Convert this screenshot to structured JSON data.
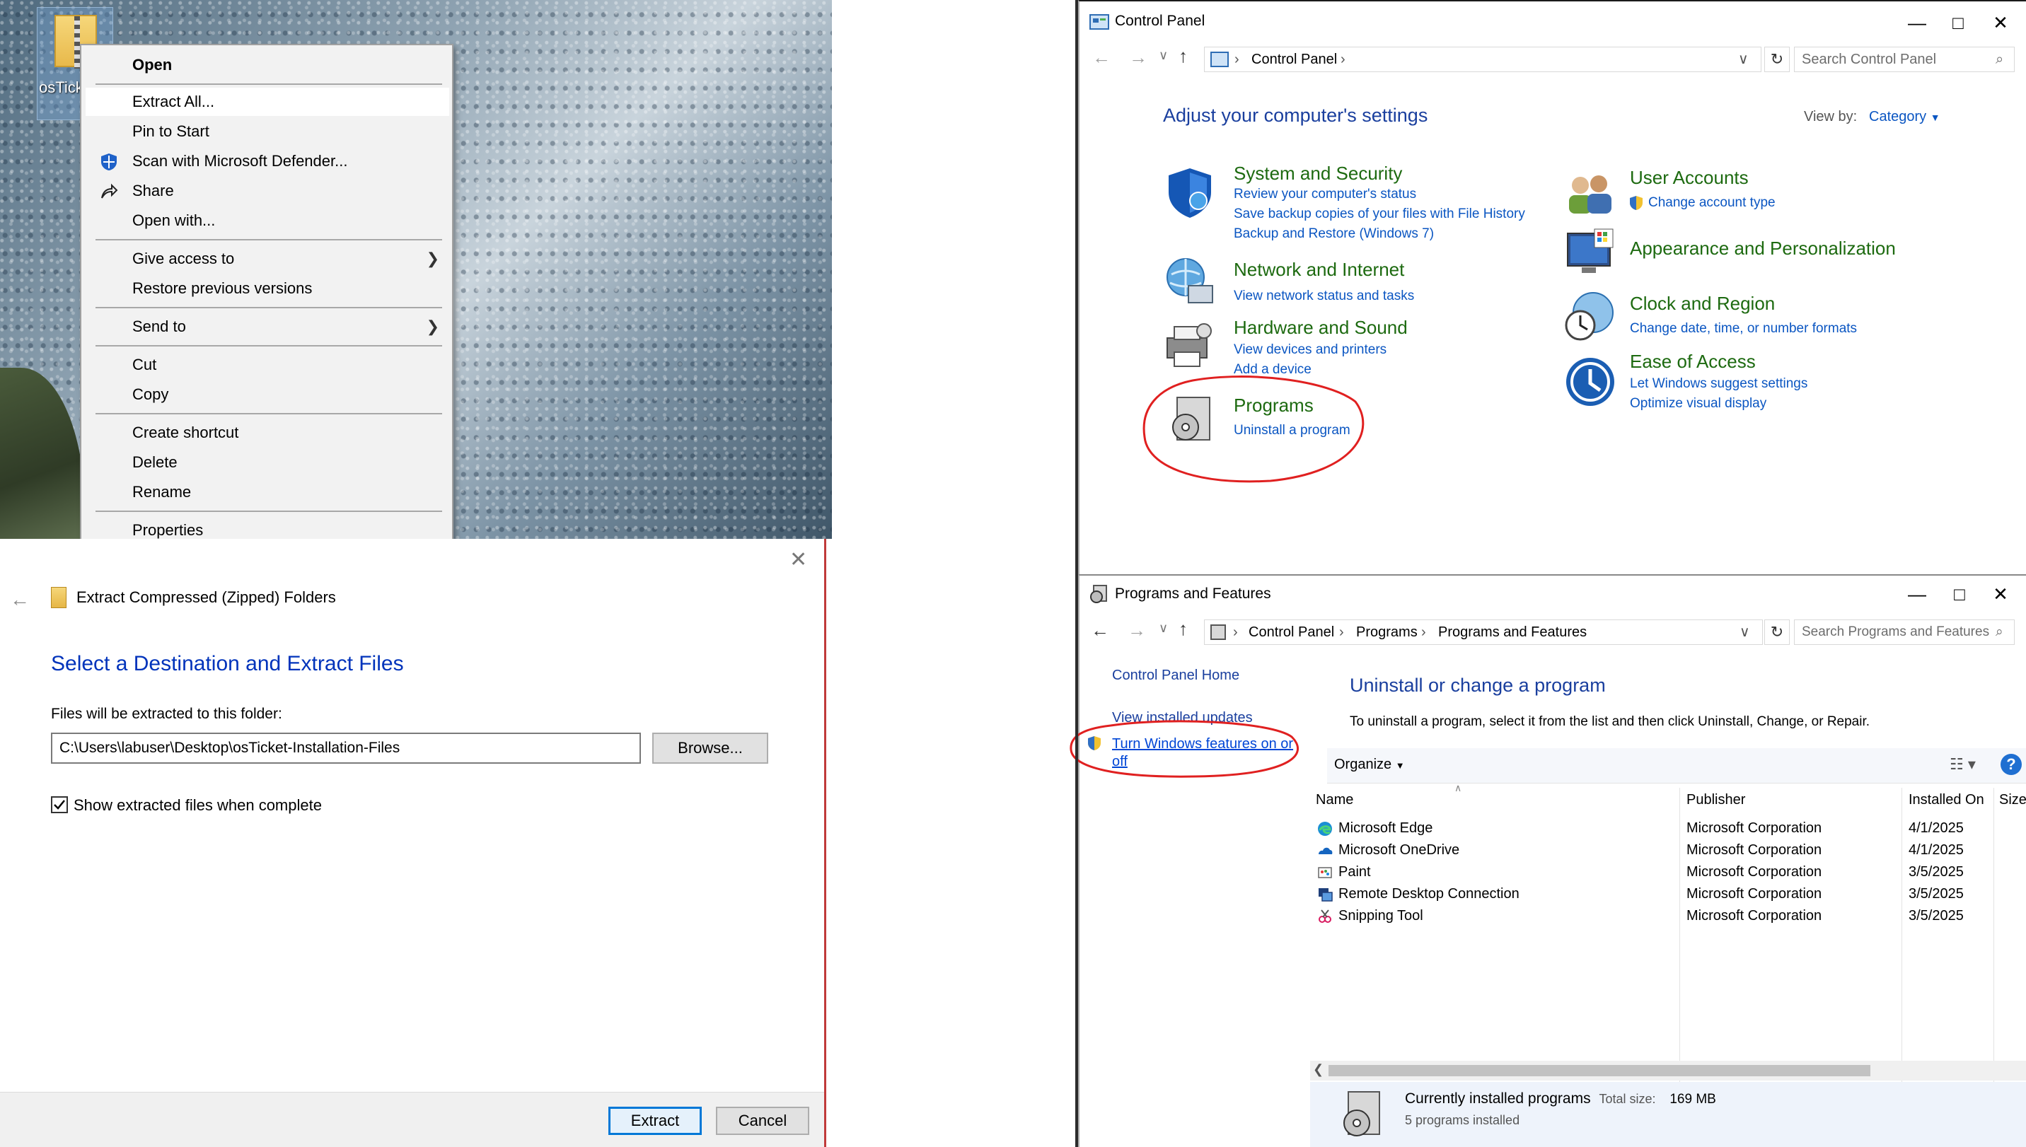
{
  "desktop": {
    "icon_label": "osTick allatic"
  },
  "context_menu": {
    "items": [
      {
        "label": "Open",
        "bold": true
      },
      {
        "label": "Extract All..."
      },
      {
        "label": "Pin to Start"
      },
      {
        "label": "Scan with Microsoft Defender..."
      },
      {
        "label": "Share"
      },
      {
        "label": "Open with..."
      },
      {
        "label": "Give access to",
        "submenu": true
      },
      {
        "label": "Restore previous versions"
      },
      {
        "label": "Send to",
        "submenu": true
      },
      {
        "label": "Cut"
      },
      {
        "label": "Copy"
      },
      {
        "label": "Create shortcut"
      },
      {
        "label": "Delete"
      },
      {
        "label": "Rename"
      },
      {
        "label": "Properties"
      }
    ]
  },
  "extract_dialog": {
    "window_title": "Extract Compressed (Zipped) Folders",
    "heading": "Select a Destination and Extract Files",
    "folder_label": "Files will be extracted to this folder:",
    "path_value": "C:\\Users\\labuser\\Desktop\\osTicket-Installation-Files",
    "browse_label": "Browse...",
    "show_files_label": "Show extracted files when complete",
    "show_files_checked": true,
    "extract_label": "Extract",
    "cancel_label": "Cancel"
  },
  "control_panel": {
    "title": "Control Panel",
    "address": "Control Panel",
    "search_placeholder": "Search Control Panel",
    "heading": "Adjust your computer's settings",
    "view_by_label": "View by:",
    "view_by_value": "Category",
    "categories": [
      {
        "title": "System and Security",
        "links": [
          "Review your computer's status",
          "Save backup copies of your files with File History",
          "Backup and Restore (Windows 7)"
        ]
      },
      {
        "title": "Network and Internet",
        "links": [
          "View network status and tasks"
        ]
      },
      {
        "title": "Hardware and Sound",
        "links": [
          "View devices and printers",
          "Add a device"
        ]
      },
      {
        "title": "Programs",
        "links": [
          "Uninstall a program"
        ]
      },
      {
        "title": "User Accounts",
        "links": [
          "Change account type"
        ]
      },
      {
        "title": "Appearance and Personalization",
        "links": []
      },
      {
        "title": "Clock and Region",
        "links": [
          "Change date, time, or number formats"
        ]
      },
      {
        "title": "Ease of Access",
        "links": [
          "Let Windows suggest settings",
          "Optimize visual display"
        ]
      }
    ],
    "colors": {
      "category_green": "#1d6a10",
      "link_blue": "#0b56c2",
      "annotation_red": "#e02020"
    }
  },
  "programs_features": {
    "title": "Programs and Features",
    "breadcrumb": [
      "Control Panel",
      "Programs",
      "Programs and Features"
    ],
    "search_placeholder": "Search Programs and Features",
    "side_links": {
      "home": "Control Panel Home",
      "updates": "View installed updates",
      "features": "Turn Windows features on or off"
    },
    "heading": "Uninstall or change a program",
    "description": "To uninstall a program, select it from the list and then click Uninstall, Change, or Repair.",
    "organize_label": "Organize",
    "columns": [
      "Name",
      "Publisher",
      "Installed On",
      "Size"
    ],
    "rows": [
      {
        "name": "Microsoft Edge",
        "publisher": "Microsoft Corporation",
        "installed": "4/1/2025",
        "icon": "edge-icon"
      },
      {
        "name": "Microsoft OneDrive",
        "publisher": "Microsoft Corporation",
        "installed": "4/1/2025",
        "icon": "onedrive-icon"
      },
      {
        "name": "Paint",
        "publisher": "Microsoft Corporation",
        "installed": "3/5/2025",
        "icon": "paint-icon"
      },
      {
        "name": "Remote Desktop Connection",
        "publisher": "Microsoft Corporation",
        "installed": "3/5/2025",
        "icon": "remote-desktop-icon"
      },
      {
        "name": "Snipping Tool",
        "publisher": "Microsoft Corporation",
        "installed": "3/5/2025",
        "icon": "snipping-tool-icon"
      }
    ],
    "status": {
      "title": "Currently installed programs",
      "total_label": "Total size:",
      "total_value": "169 MB",
      "count_text": "5 programs installed"
    }
  }
}
